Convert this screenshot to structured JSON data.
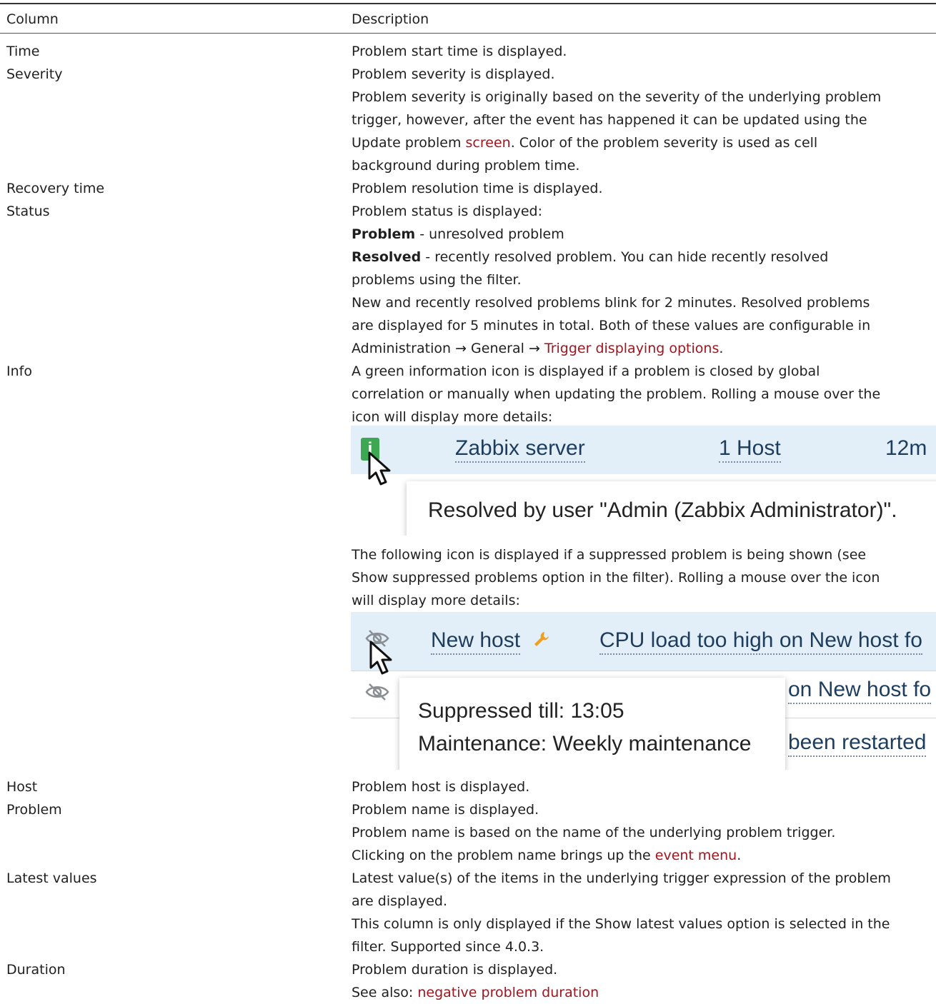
{
  "header": {
    "col1": "Column",
    "col2": "Description"
  },
  "rows": {
    "time": {
      "name": "Time",
      "desc": "Problem start time is displayed."
    },
    "severity": {
      "name": "Severity",
      "l1": "Problem severity is displayed.",
      "l2": "Problem severity is originally based on the severity of the underlying problem",
      "l3": "trigger, however, after the event has happened it can be updated using the",
      "l4a": "Update problem ",
      "l4link": "screen",
      "l4b": ". Color of the problem severity is used as cell",
      "l5": "background during problem time."
    },
    "recovery": {
      "name": "Recovery time",
      "desc": "Problem resolution time is displayed."
    },
    "status": {
      "name": "Status",
      "l1": "Problem status is displayed:",
      "l2bold": "Problem",
      "l2rest": " - unresolved problem",
      "l3bold": "Resolved",
      "l3rest": " - recently resolved problem. You can hide recently resolved",
      "l4": "problems using the filter.",
      "l5": "New and recently resolved problems blink for 2 minutes. Resolved problems",
      "l6": "are displayed for 5 minutes in total. Both of these values are configurable in",
      "l7a": "Administration → General → ",
      "l7link": "Trigger displaying options",
      "l7b": "."
    },
    "info": {
      "name": "Info",
      "l1": "A green information icon is displayed if a problem is closed by global",
      "l2": "correlation or manually when updating the problem. Rolling a mouse over the",
      "l3": "icon will display more details:",
      "l4": "The following icon is displayed if a suppressed problem is being shown (see",
      "l5": "Show suppressed problems option in the filter). Rolling a mouse over the icon",
      "l6": "will display more details:"
    },
    "host": {
      "name": "Host",
      "desc": "Problem host is displayed."
    },
    "problem": {
      "name": "Problem",
      "l1": "Problem name is displayed.",
      "l2": "Problem name is based on the name of the underlying problem trigger.",
      "l3a": "Clicking on the problem name brings up the ",
      "l3link": "event menu",
      "l3b": "."
    },
    "latest": {
      "name": "Latest values",
      "l1": "Latest value(s) of the items in the underlying trigger expression of the problem",
      "l2": "are displayed.",
      "l3": "This column is only displayed if the Show latest values option is selected in the",
      "l4": "filter. Supported since 4.0.3."
    },
    "duration": {
      "name": "Duration",
      "l1": "Problem duration is displayed.",
      "l2a": "See also: ",
      "l2link": "negative problem duration"
    }
  },
  "screenshot1": {
    "info_icon": "i",
    "host": "Zabbix server",
    "hosts_count": "1 Host",
    "time_fragment": "12m",
    "tooltip": "Resolved by user \"Admin (Zabbix Administrator)\"."
  },
  "screenshot2": {
    "host": "New host",
    "problem1": "CPU load too high on New host fo",
    "problem2_fragment": "on New host fo",
    "problem3_fragment": "been restarted",
    "tooltip_line1": "Suppressed till: 13:05",
    "tooltip_line2": "Maintenance: Weekly maintenance"
  },
  "colors": {
    "link": "#a0161f",
    "info_green": "#3da851",
    "row_highlight": "#e3eff8"
  }
}
